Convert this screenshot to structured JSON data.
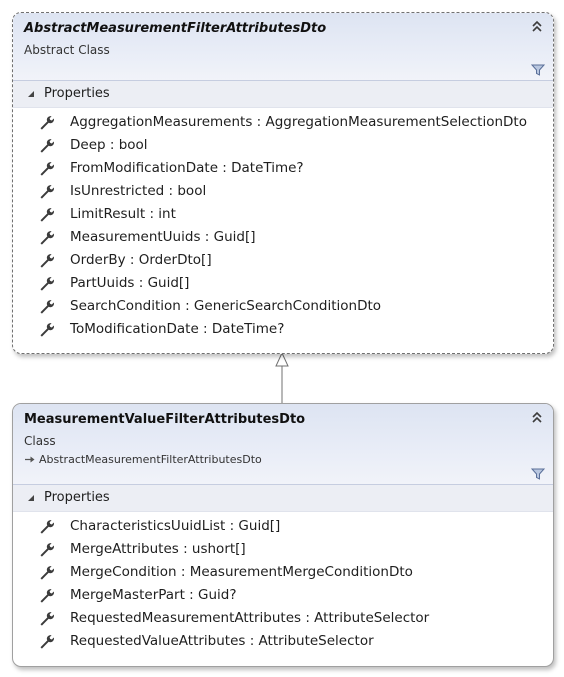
{
  "colors": {
    "header_gradient_top": "#dde4f2",
    "header_gradient_bottom": "#f1f3f9",
    "section_bg": "#eceef4",
    "border": "#a0a0a0",
    "icon": "#3c3c3c"
  },
  "classes": [
    {
      "name": "AbstractMeasurementFilterAttributesDto",
      "kind": "Abstract Class",
      "is_abstract": true,
      "inherits": "",
      "section_label": "Properties",
      "properties": [
        "AggregationMeasurements : AggregationMeasurementSelectionDto",
        "Deep : bool",
        "FromModificationDate : DateTime?",
        "IsUnrestricted : bool",
        "LimitResult : int",
        "MeasurementUuids : Guid[]",
        "OrderBy : OrderDto[]",
        "PartUuids : Guid[]",
        "SearchCondition : GenericSearchConditionDto",
        "ToModificationDate : DateTime?"
      ]
    },
    {
      "name": "MeasurementValueFilterAttributesDto",
      "kind": "Class",
      "is_abstract": false,
      "inherits": "AbstractMeasurementFilterAttributesDto",
      "section_label": "Properties",
      "properties": [
        "CharacteristicsUuidList : Guid[]",
        "MergeAttributes : ushort[]",
        "MergeCondition : MeasurementMergeConditionDto",
        "MergeMasterPart : Guid?",
        "RequestedMeasurementAttributes : AttributeSelector",
        "RequestedValueAttributes : AttributeSelector"
      ]
    }
  ],
  "icons": {
    "property": "wrench-icon",
    "collapse": "double-chevron-up-icon",
    "filter": "filter-icon",
    "section_toggle": "triangle-expanded-icon",
    "inheritance": "inheritance-arrow-icon"
  }
}
